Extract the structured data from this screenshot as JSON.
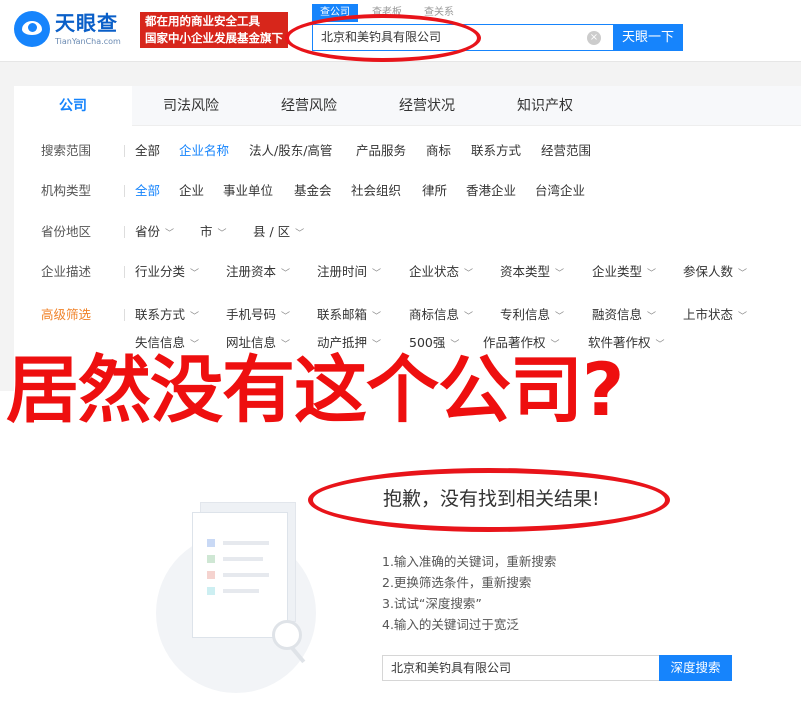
{
  "header": {
    "logo_text": "天眼查",
    "logo_sub": "TianYanCha.com",
    "slogan_line1": "都在用的商业安全工具",
    "slogan_line2": "国家中小企业发展基金旗下",
    "search_tabs": [
      "查公司",
      "查老板",
      "查关系"
    ],
    "search_value": "北京和美钓具有限公司",
    "search_button": "天眼一下",
    "clear_icon": "×"
  },
  "tabs": [
    "公司",
    "司法风险",
    "经营风险",
    "经营状况",
    "知识产权"
  ],
  "filters": {
    "scope": {
      "label": "搜索范围",
      "options": [
        "全部",
        "企业名称",
        "法人/股东/高管",
        "产品服务",
        "商标",
        "联系方式",
        "经营范围"
      ],
      "selected": 1
    },
    "org_type": {
      "label": "机构类型",
      "options": [
        "全部",
        "企业",
        "事业单位",
        "基金会",
        "社会组织",
        "律所",
        "香港企业",
        "台湾企业"
      ],
      "selected": 0
    },
    "region": {
      "label": "省份地区",
      "options": [
        "省份",
        "市",
        "县 / 区"
      ]
    },
    "desc": {
      "label": "企业描述",
      "options": [
        "行业分类",
        "注册资本",
        "注册时间",
        "企业状态",
        "资本类型",
        "企业类型",
        "参保人数"
      ]
    },
    "advanced": {
      "label": "高级筛选",
      "row1": [
        "联系方式",
        "手机号码",
        "联系邮箱",
        "商标信息",
        "专利信息",
        "融资信息",
        "上市状态"
      ],
      "row2": [
        "失信信息",
        "网址信息",
        "动产抵押",
        "500强",
        "作品著作权",
        "软件著作权"
      ]
    }
  },
  "caption": "居然没有这个公司?",
  "empty": {
    "title": "抱歉，没有找到相关结果!",
    "tips": [
      "1.输入准确的关键词，重新搜索",
      "2.更换筛选条件，重新搜索",
      "3.试试“深度搜索”",
      "4.输入的关键词过于宽泛"
    ],
    "deep_value": "北京和美钓具有限公司",
    "deep_button": "深度搜索"
  },
  "colors": {
    "brand": "#1684fc",
    "highlight": "#e8141a",
    "advanced_label": "#f08228"
  }
}
